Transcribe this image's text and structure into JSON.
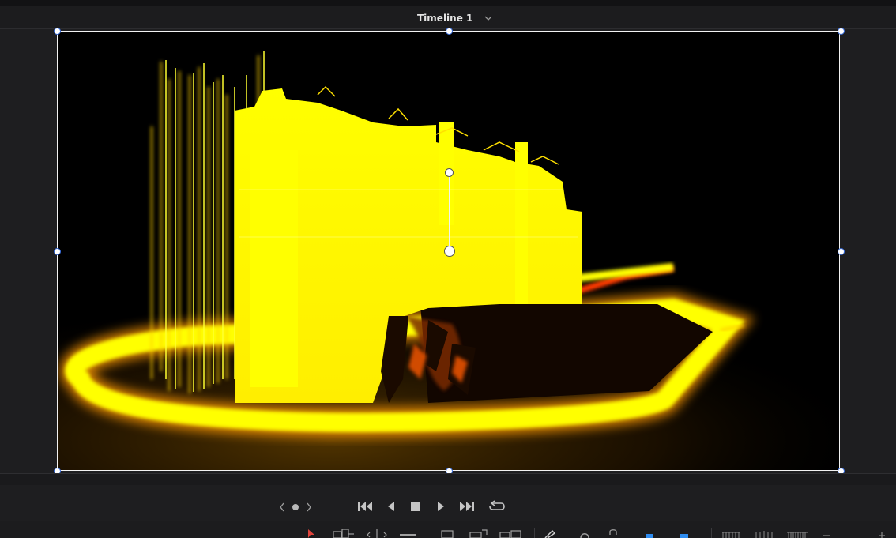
{
  "viewer": {
    "timeline_name": "Timeline 1"
  },
  "colors": {
    "background": "#1c1c1e",
    "frame_border": "#f2f2f2",
    "handle_accent": "#3a6fe0",
    "glow_yellow": "#ffff00",
    "glow_orange": "#ff9a00",
    "toolbar_red": "#e0443c",
    "toolbar_blue": "#2e8cf0"
  },
  "icons": {
    "timeline_dropdown": "chevron-down-icon",
    "jog_prev": "chevron-left-icon",
    "jog_dot": "dot-icon",
    "jog_next": "chevron-right-icon",
    "skip_start": "skip-to-start-icon",
    "play_reverse": "play-reverse-icon",
    "stop": "stop-icon",
    "play": "play-icon",
    "skip_end": "skip-to-end-icon",
    "loop": "loop-icon"
  }
}
